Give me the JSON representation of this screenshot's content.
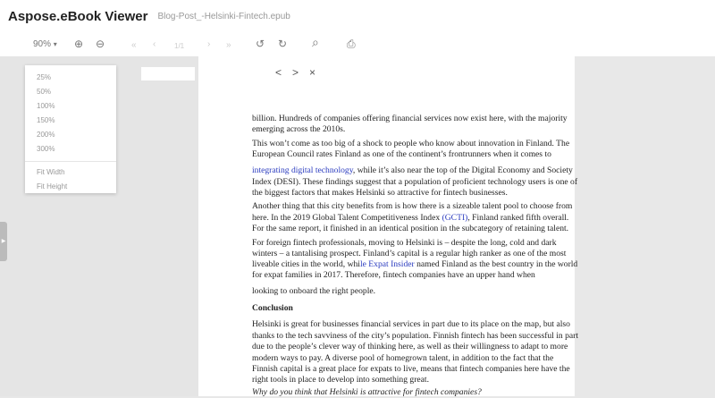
{
  "header": {
    "title": "Aspose.eBook Viewer",
    "file": "Blog-Post_-Helsinki-Fintech.epub"
  },
  "toolbar": {
    "zoom": "90%",
    "zoom_caret": "▾",
    "zoom_in": "⊕",
    "zoom_out": "⊖",
    "first": "«",
    "prev": "‹",
    "page": "1/1",
    "next": "›",
    "last": "»",
    "rotate_left": "↺",
    "rotate_right": "↻",
    "search": "⌕",
    "print": "⎙"
  },
  "zoom_menu": {
    "options": [
      "25%",
      "50%",
      "100%",
      "150%",
      "200%",
      "300%"
    ],
    "fit": [
      "Fit Width",
      "Fit Height"
    ]
  },
  "overlay": {
    "prev": "<",
    "next": ">",
    "close": "×"
  },
  "content": {
    "lines": [
      {
        "t": "billion. Hundreds of companies offering financial services now exist here, with the majority"
      },
      {
        "t": "emerging across the 2010s."
      },
      {
        "t": "This won’t come as too big of a shock to people who know about innovation in Finland. The"
      },
      {
        "t": "European Council rates Finland as one of the continent’s frontrunners when it comes to"
      },
      {
        "link": "integrating digital technology",
        "t": ", while it’s also near the top of the Digital Economy and Society"
      },
      {
        "t": "Index (DESI). These findings suggest that a population of proficient technology users is one of"
      },
      {
        "t": "the biggest factors that makes Helsinki so attractive for fintech businesses."
      },
      {
        "t": "Another thing that this city benefits from is how there is a sizeable talent pool to choose from"
      },
      {
        "pre": "here. In the 2019 Global Talent Competitiveness Index ",
        "link": "(GCTI)",
        "t": ", Finland ranked fifth overall."
      },
      {
        "t": "For the same report, it finished in an identical position in the subcategory of retaining talent."
      },
      {
        "t": "For foreign fintech professionals, moving to Helsinki is – despite the long, cold and dark"
      },
      {
        "t": "winters – a tantalising prospect. Finland’s capital is a regular high ranker as one of the most"
      },
      {
        "pre": "liveable cities in the world, whi",
        "link": "le Expat Insider",
        "t": " named Finland as the best country in the world"
      },
      {
        "t": "for expat families in 2017. Therefore, fintech companies have an upper hand when"
      },
      {
        "t": "looking to onboard the right people."
      },
      {
        "t": "Conclusion",
        "b": true
      },
      {
        "t": "Helsinki is great for businesses financial services in part due to its place on the map, but also"
      },
      {
        "t": "thanks to the tech savviness of the city’s population. Finnish fintech has been successful in part"
      },
      {
        "t": "due to the people’s clever way of thinking here, as well as their willingness to adapt to more"
      },
      {
        "t": "modern ways to pay. A diverse pool of homegrown talent, in addition to the fact that the"
      },
      {
        "t": "Finnish capital is a great place for expats to live, means that fintech companies here have the"
      },
      {
        "t": "right tools in place to develop into something great."
      },
      {
        "t": "Why do you think that Helsinki is attractive for fintech companies?",
        "i": true
      }
    ]
  }
}
